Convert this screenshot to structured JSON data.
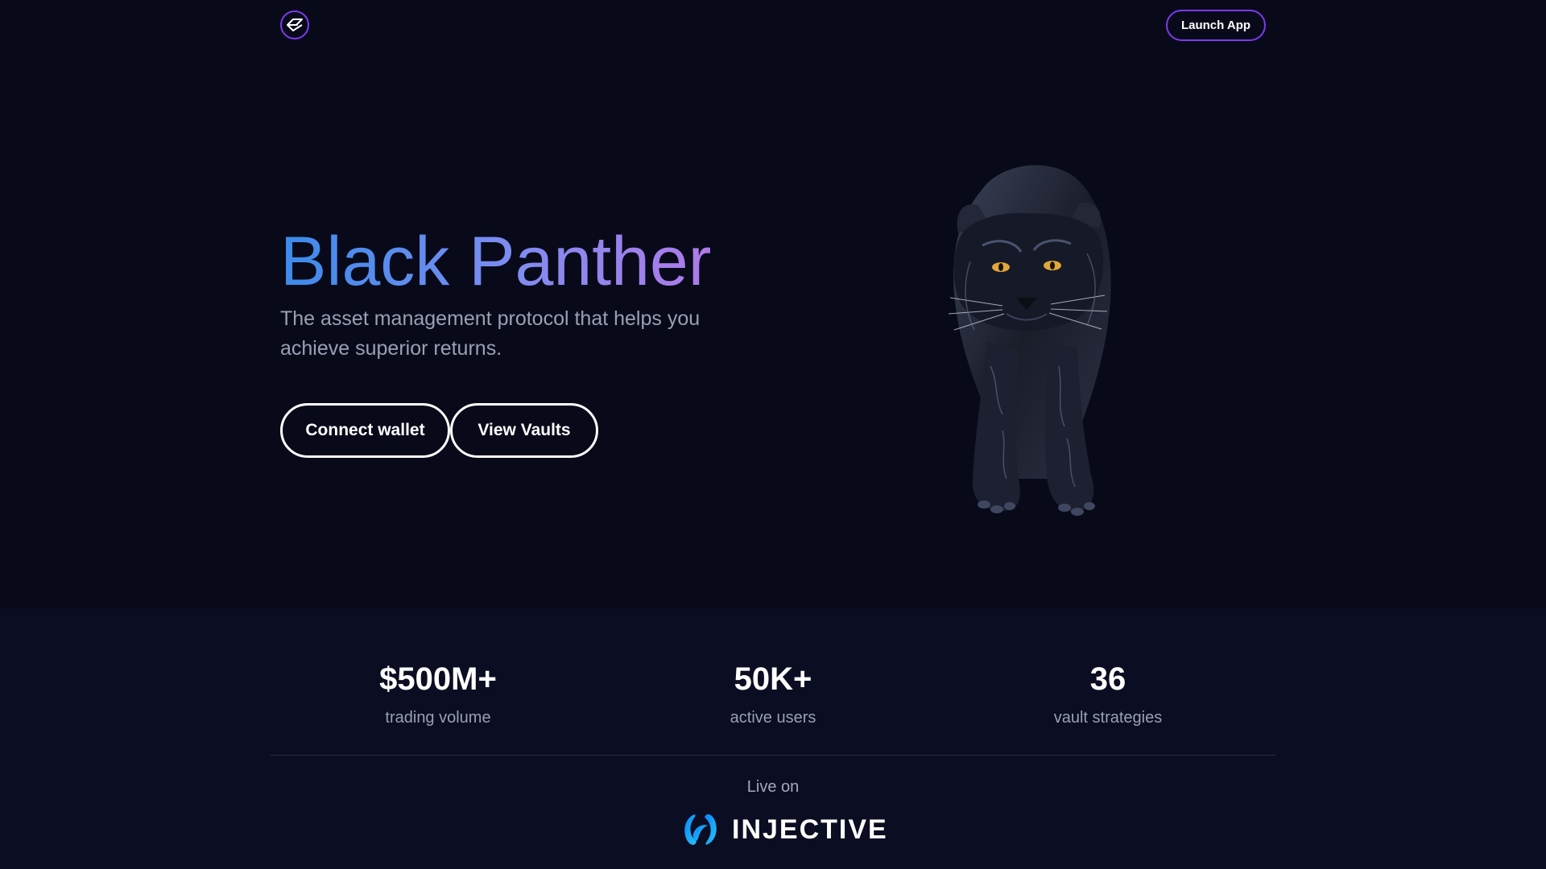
{
  "nav": {
    "logo_icon": "diamond-ring-logo-icon",
    "launch_label": "Launch App"
  },
  "hero": {
    "title": "Black Panther",
    "subtitle": "The asset management protocol that helps you achieve superior returns.",
    "connect_label": "Connect wallet",
    "vaults_label": "View Vaults",
    "image": "black-panther-illustration"
  },
  "stats": [
    {
      "value": "$500M+",
      "label": "trading volume"
    },
    {
      "value": "50K+",
      "label": "active users"
    },
    {
      "value": "36",
      "label": "vault strategies"
    }
  ],
  "footer": {
    "live_on": "Live on",
    "partner_name": "INJECTIVE",
    "partner_icon": "injective-logo-icon"
  },
  "colors": {
    "background": "#080a1a",
    "accent": "#7c3aed",
    "title_gradient_start": "#3b8bea",
    "title_gradient_end": "#b07ae8",
    "panther_eye": "#e0a73a"
  }
}
